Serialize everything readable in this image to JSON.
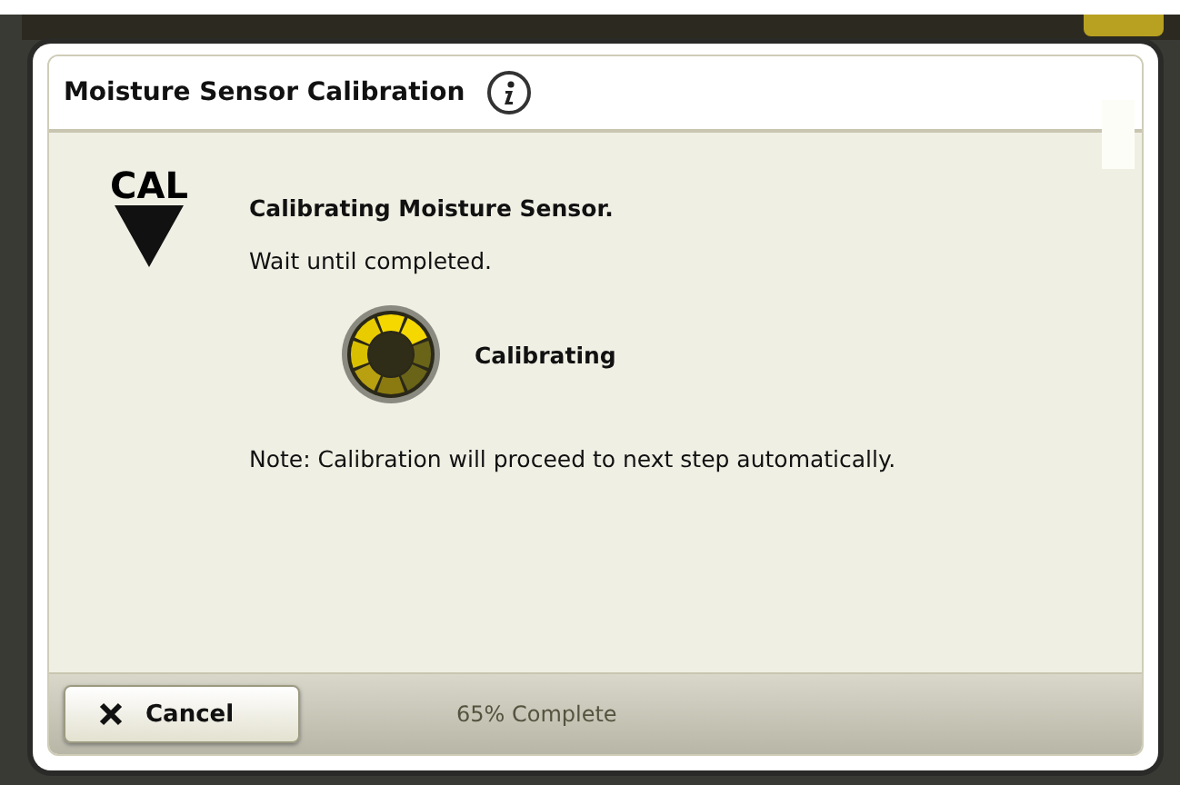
{
  "dialog": {
    "title": "Moisture Sensor Calibration",
    "step_badge": "CAL",
    "heading": "Calibrating Moisture Sensor.",
    "instruction": "Wait until completed.",
    "status": "Calibrating",
    "note": "Note: Calibration will proceed to next step automatically.",
    "cancel_button": "Cancel",
    "progress_text": "65% Complete"
  }
}
